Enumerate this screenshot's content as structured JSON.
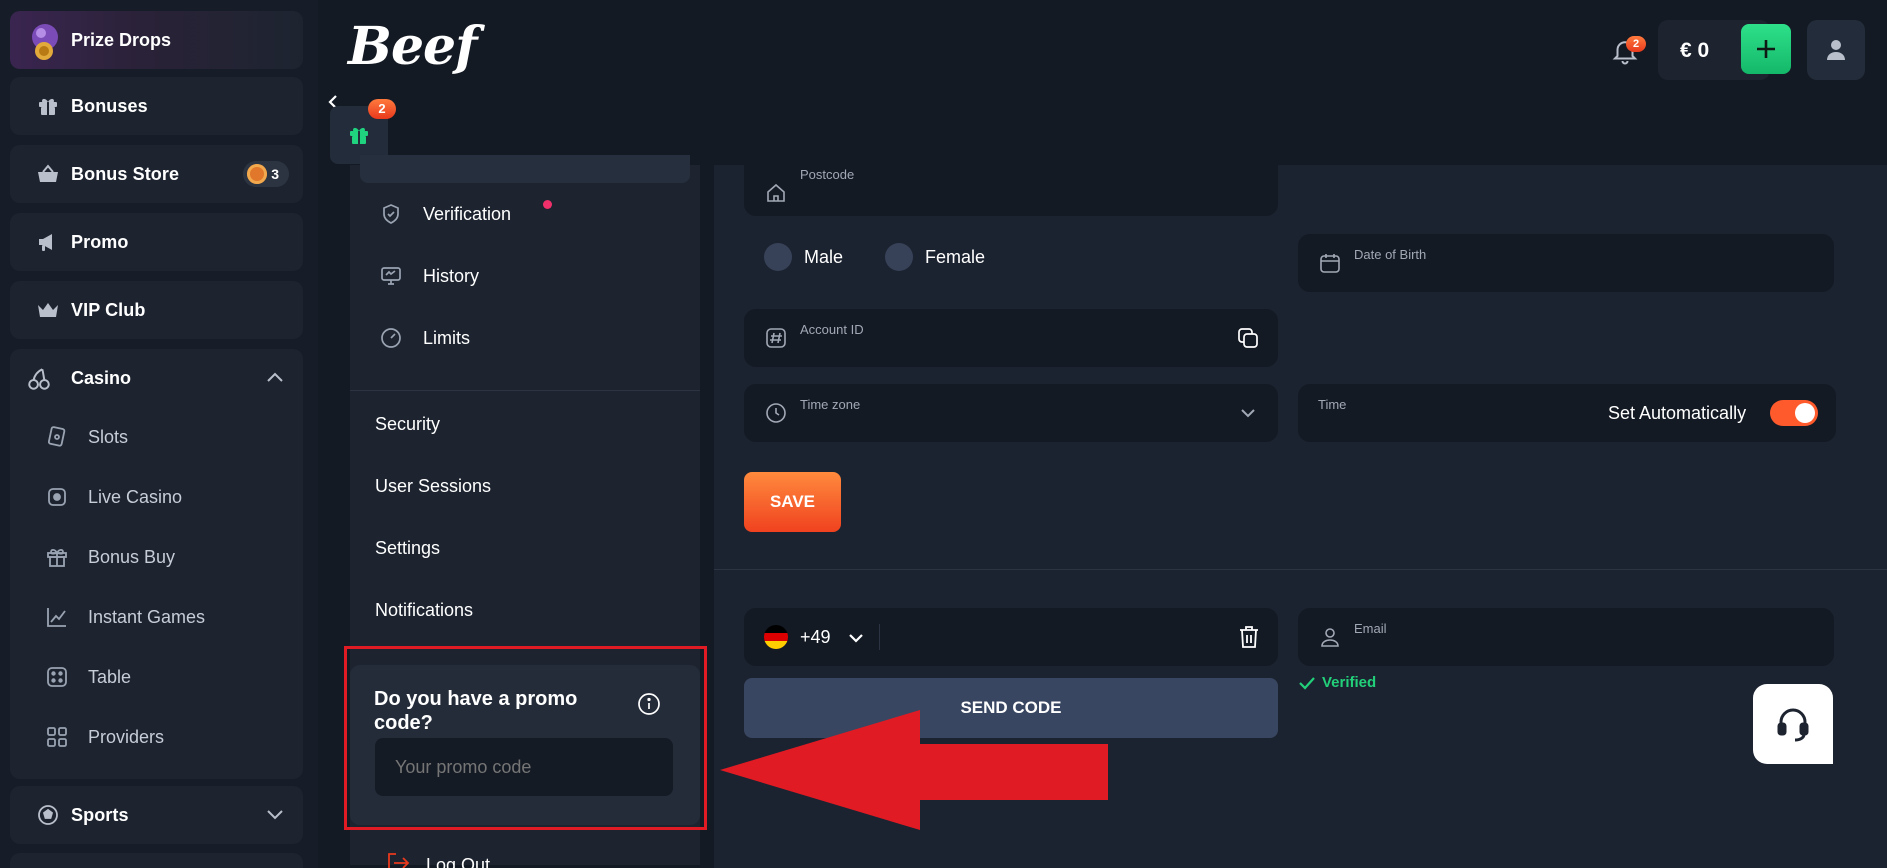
{
  "colors": {
    "accent_green": "#1fd37f",
    "accent_orange": "#ff5a2b",
    "badge_red": "#f04e23",
    "highlight_red": "#e01b24",
    "verified_green": "#22d07a"
  },
  "sidebar": {
    "prize_drops": "Prize Drops",
    "items": [
      {
        "label": "Bonuses",
        "icon": "gift-icon"
      },
      {
        "label": "Bonus Store",
        "icon": "basket-icon",
        "badge": "3"
      },
      {
        "label": "Promo",
        "icon": "megaphone-icon"
      },
      {
        "label": "VIP Club",
        "icon": "crown-icon"
      },
      {
        "label": "Casino",
        "icon": "cherries-icon"
      },
      {
        "label": "Sports",
        "icon": "ball-icon"
      }
    ],
    "casino_sub": [
      {
        "label": "Slots",
        "icon": "slots-icon"
      },
      {
        "label": "Live Casino",
        "icon": "live-icon"
      },
      {
        "label": "Bonus Buy",
        "icon": "gift-icon"
      },
      {
        "label": "Instant Games",
        "icon": "chart-icon"
      },
      {
        "label": "Table",
        "icon": "dice-icon"
      },
      {
        "label": "Providers",
        "icon": "grid-icon"
      }
    ]
  },
  "header": {
    "logo": "Beef",
    "notification_badge": "2",
    "balance": "€ 0",
    "gift_badge": "2"
  },
  "profile_nav": {
    "verification": "Verification",
    "history": "History",
    "limits": "Limits",
    "security": "Security",
    "user_sessions": "User Sessions",
    "settings": "Settings",
    "notifications": "Notifications",
    "promo_title": "Do you have a promo code?",
    "promo_placeholder": "Your promo code",
    "logout": "Log Out"
  },
  "form": {
    "postcode_label": "Postcode",
    "gender_male": "Male",
    "gender_female": "Female",
    "dob_label": "Date of Birth",
    "account_id_label": "Account ID",
    "timezone_label": "Time zone",
    "time_label": "Time",
    "set_auto_label": "Set Automatically",
    "set_auto_on": true,
    "save_label": "SAVE",
    "phone_code": "+49",
    "email_label": "Email",
    "verified_label": "Verified",
    "send_code_label": "SEND CODE"
  }
}
